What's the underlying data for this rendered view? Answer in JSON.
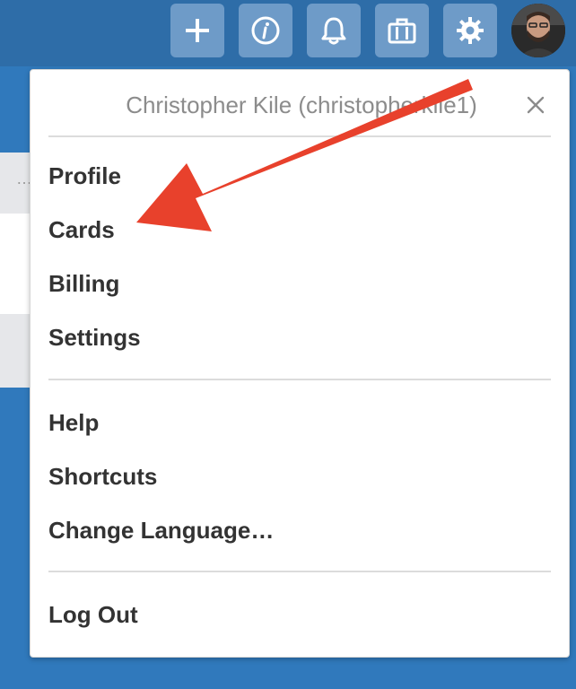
{
  "topbar": {
    "buttons": [
      {
        "icon": "plus-icon"
      },
      {
        "icon": "info-icon"
      },
      {
        "icon": "bell-icon"
      },
      {
        "icon": "briefcase-icon"
      },
      {
        "icon": "gear-icon"
      }
    ],
    "avatar_icon": "avatar"
  },
  "background": {
    "dots": "…"
  },
  "popover": {
    "title": "Christopher Kile (christopherkile1)",
    "close_icon": "close-icon",
    "menu_groups": [
      [
        "Profile",
        "Cards",
        "Billing",
        "Settings"
      ],
      [
        "Help",
        "Shortcuts",
        "Change Language…"
      ],
      [
        "Log Out"
      ]
    ]
  },
  "annotation": {
    "arrow_color": "#e8412c",
    "points_to": "Cards"
  },
  "colors": {
    "app_background": "#3079bc",
    "header_bar": "#2e6da8",
    "header_button": "#6e9bc8",
    "menu_text": "#333333",
    "title_text": "#8c8c8c"
  }
}
